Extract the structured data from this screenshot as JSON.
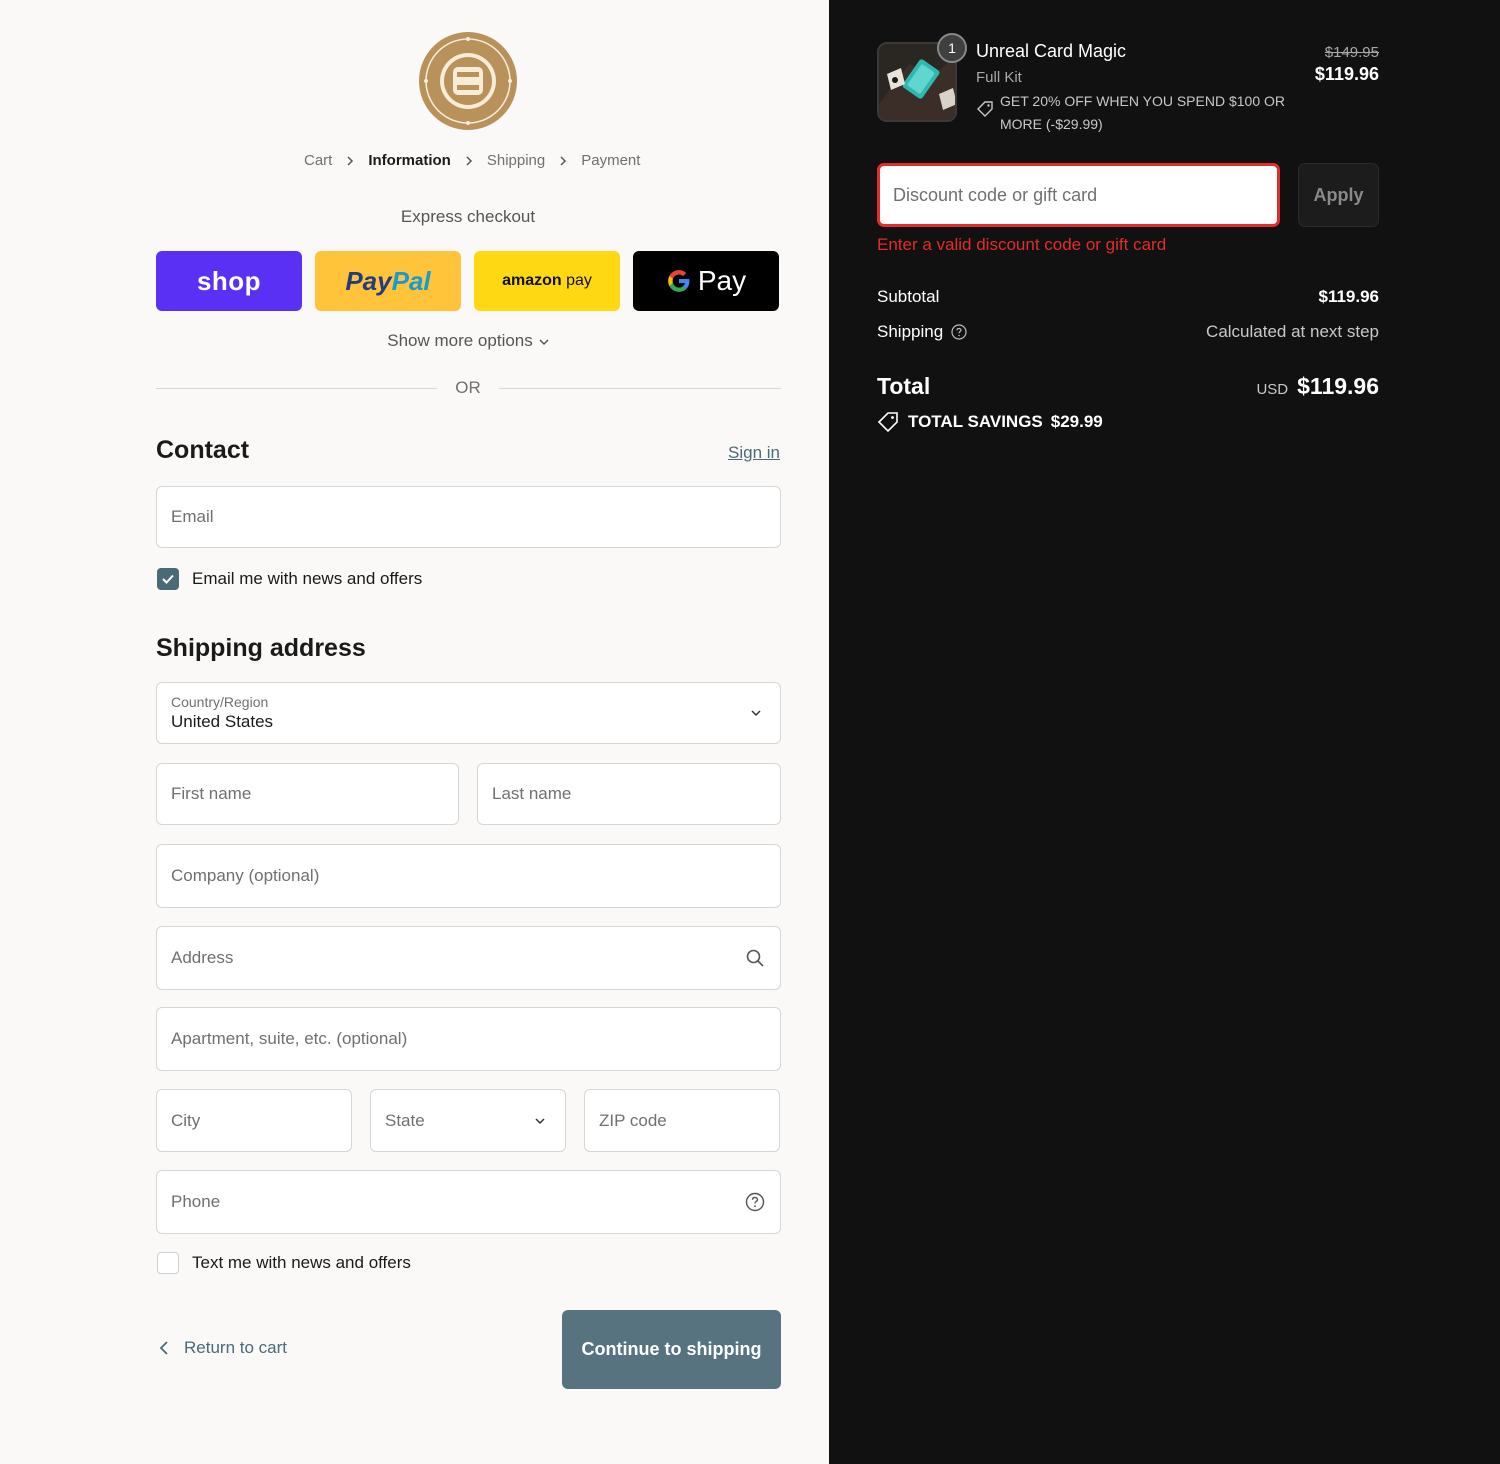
{
  "breadcrumb": {
    "cart": "Cart",
    "information": "Information",
    "shipping": "Shipping",
    "payment": "Payment"
  },
  "express": {
    "title": "Express checkout",
    "shop_label": "shop",
    "paypal_part1": "Pay",
    "paypal_part2": "Pal",
    "amazon_part1": "amazon",
    "amazon_part2": " pay",
    "gpay_label": "Pay",
    "show_more": "Show more options",
    "or": "OR"
  },
  "contact": {
    "title": "Contact",
    "signin": "Sign in",
    "email_placeholder": "Email",
    "email_optin_label": "Email me with news and offers",
    "email_optin_checked": true
  },
  "shipping": {
    "title": "Shipping address",
    "country_label": "Country/Region",
    "country_value": "United States",
    "first_name": "First name",
    "last_name": "Last name",
    "company": "Company (optional)",
    "address": "Address",
    "apartment": "Apartment, suite, etc. (optional)",
    "city": "City",
    "state": "State",
    "zip": "ZIP code",
    "phone": "Phone",
    "sms_optin_label": "Text me with news and offers",
    "sms_optin_checked": false
  },
  "actions": {
    "return": "Return to cart",
    "continue": "Continue to shipping"
  },
  "order": {
    "quantity": "1",
    "product_name": "Unreal Card Magic",
    "variant": "Full Kit",
    "promo": "GET 20% OFF WHEN YOU SPEND $100 OR MORE (-$29.99)",
    "price_old": "$149.95",
    "price_new": "$119.96"
  },
  "discount": {
    "placeholder": "Discount code or gift card",
    "apply": "Apply",
    "error": "Enter a valid discount code or gift card"
  },
  "summary": {
    "subtotal_label": "Subtotal",
    "subtotal_value": "$119.96",
    "shipping_label": "Shipping",
    "shipping_value": "Calculated at next step",
    "total_label": "Total",
    "currency": "USD",
    "total_value": "$119.96",
    "savings_label": "TOTAL SAVINGS",
    "savings_value": "$29.99"
  },
  "colors": {
    "accent": "#577380",
    "error": "#e32c2b",
    "shop_pay": "#5a31f4",
    "paypal": "#ffc439",
    "amazon_pay": "#ffd814",
    "logo_gold": "#b8925a"
  },
  "icons": [
    "logo-badge",
    "chevron-right-icon",
    "chevron-down-icon",
    "search-icon",
    "help-circle-icon",
    "checkmark-icon",
    "chevron-left-icon",
    "tag-icon",
    "google-g-icon"
  ]
}
